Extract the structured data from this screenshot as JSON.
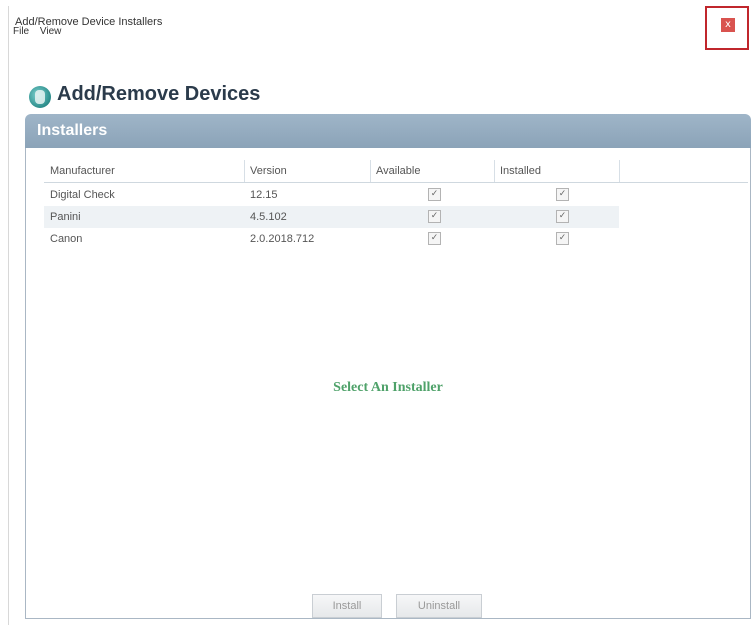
{
  "window": {
    "title": "Add/Remove Device Installers"
  },
  "menubar": [
    "File",
    "View"
  ],
  "page": {
    "title": "Add/Remove Devices"
  },
  "panel": {
    "title": "Installers"
  },
  "table": {
    "headers": [
      "Manufacturer",
      "Version",
      "Available",
      "Installed"
    ],
    "rows": [
      {
        "manufacturer": "Digital Check",
        "version": "12.15",
        "available": true,
        "installed": true
      },
      {
        "manufacturer": "Panini",
        "version": "4.5.102",
        "available": true,
        "installed": true
      },
      {
        "manufacturer": "Canon",
        "version": "2.0.2018.712",
        "available": true,
        "installed": true
      }
    ]
  },
  "message": {
    "text": "Select An Installer"
  },
  "buttons": {
    "install": "Install",
    "uninstall": "Uninstall"
  },
  "check_glyph": "✓",
  "close_glyph": "x",
  "colors": {
    "panel_header": "#9fb5c8",
    "title_text": "#2b3b4b",
    "message_text": "#4fa26a",
    "close_highlight": "#c0262c"
  }
}
